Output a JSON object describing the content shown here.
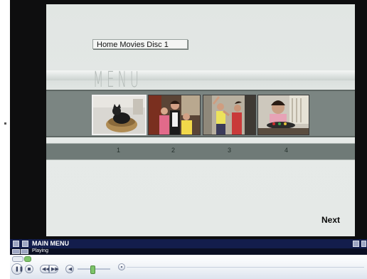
{
  "dvd_menu": {
    "disc_title": "Home Movies Disc 1",
    "heading": "MENU",
    "chapters": [
      "1",
      "2",
      "3",
      "4"
    ],
    "next_label": "Next"
  },
  "player": {
    "title": "MAIN MENU",
    "status": "Playing"
  },
  "icons": [
    "pause-icon",
    "stop-icon",
    "previous-icon",
    "next-icon",
    "mute-icon",
    "volume-slider",
    "fullscreen-icon"
  ]
}
